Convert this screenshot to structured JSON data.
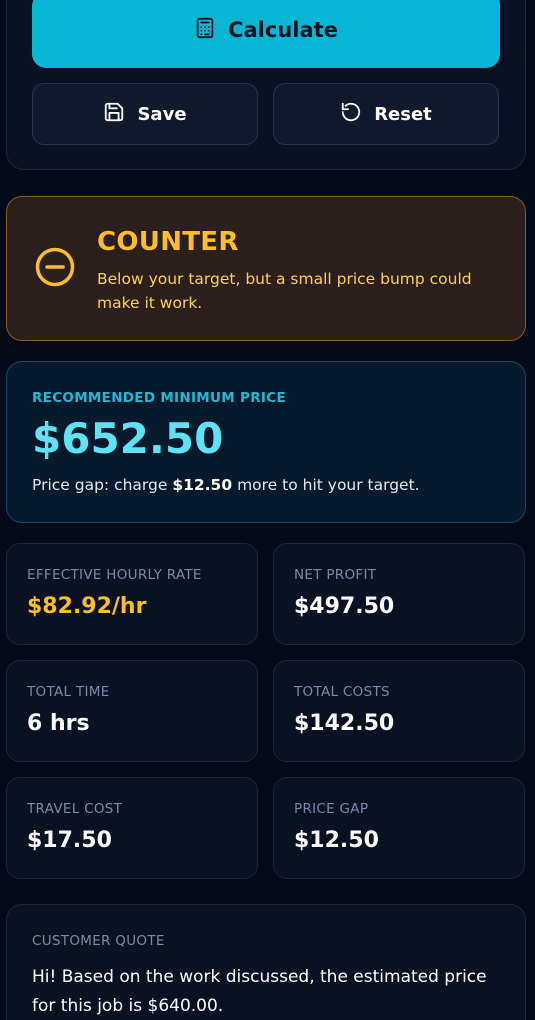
{
  "actions": {
    "calculate_label": "Calculate",
    "save_label": "Save",
    "reset_label": "Reset"
  },
  "verdict": {
    "icon": "minus-circle-icon",
    "title": "COUNTER",
    "message": "Below your target, but a small price bump could make it work.",
    "color": "#fbbf24"
  },
  "recommendation": {
    "label": "RECOMMENDED MINIMUM PRICE",
    "value": "$652.50",
    "gap_prefix": "Price gap: charge ",
    "gap_amount": "$12.50",
    "gap_suffix": " more to hit your target."
  },
  "stats": [
    {
      "label": "EFFECTIVE HOURLY RATE",
      "value": "$82.92/hr"
    },
    {
      "label": "NET PROFIT",
      "value": "$497.50"
    },
    {
      "label": "TOTAL TIME",
      "value": "6 hrs"
    },
    {
      "label": "TOTAL COSTS",
      "value": "$142.50"
    },
    {
      "label": "TRAVEL COST",
      "value": "$17.50"
    },
    {
      "label": "PRICE GAP",
      "value": "$12.50"
    }
  ],
  "quote": {
    "label": "CUSTOMER QUOTE",
    "text": "Hi! Based on the work discussed, the estimated price for this job is $640.00."
  },
  "colors": {
    "primary": "#06b6d4",
    "background": "#050a18",
    "card": "#0a1122",
    "accent_cyan": "#5ee3f5",
    "accent_amber": "#fbbf24"
  }
}
